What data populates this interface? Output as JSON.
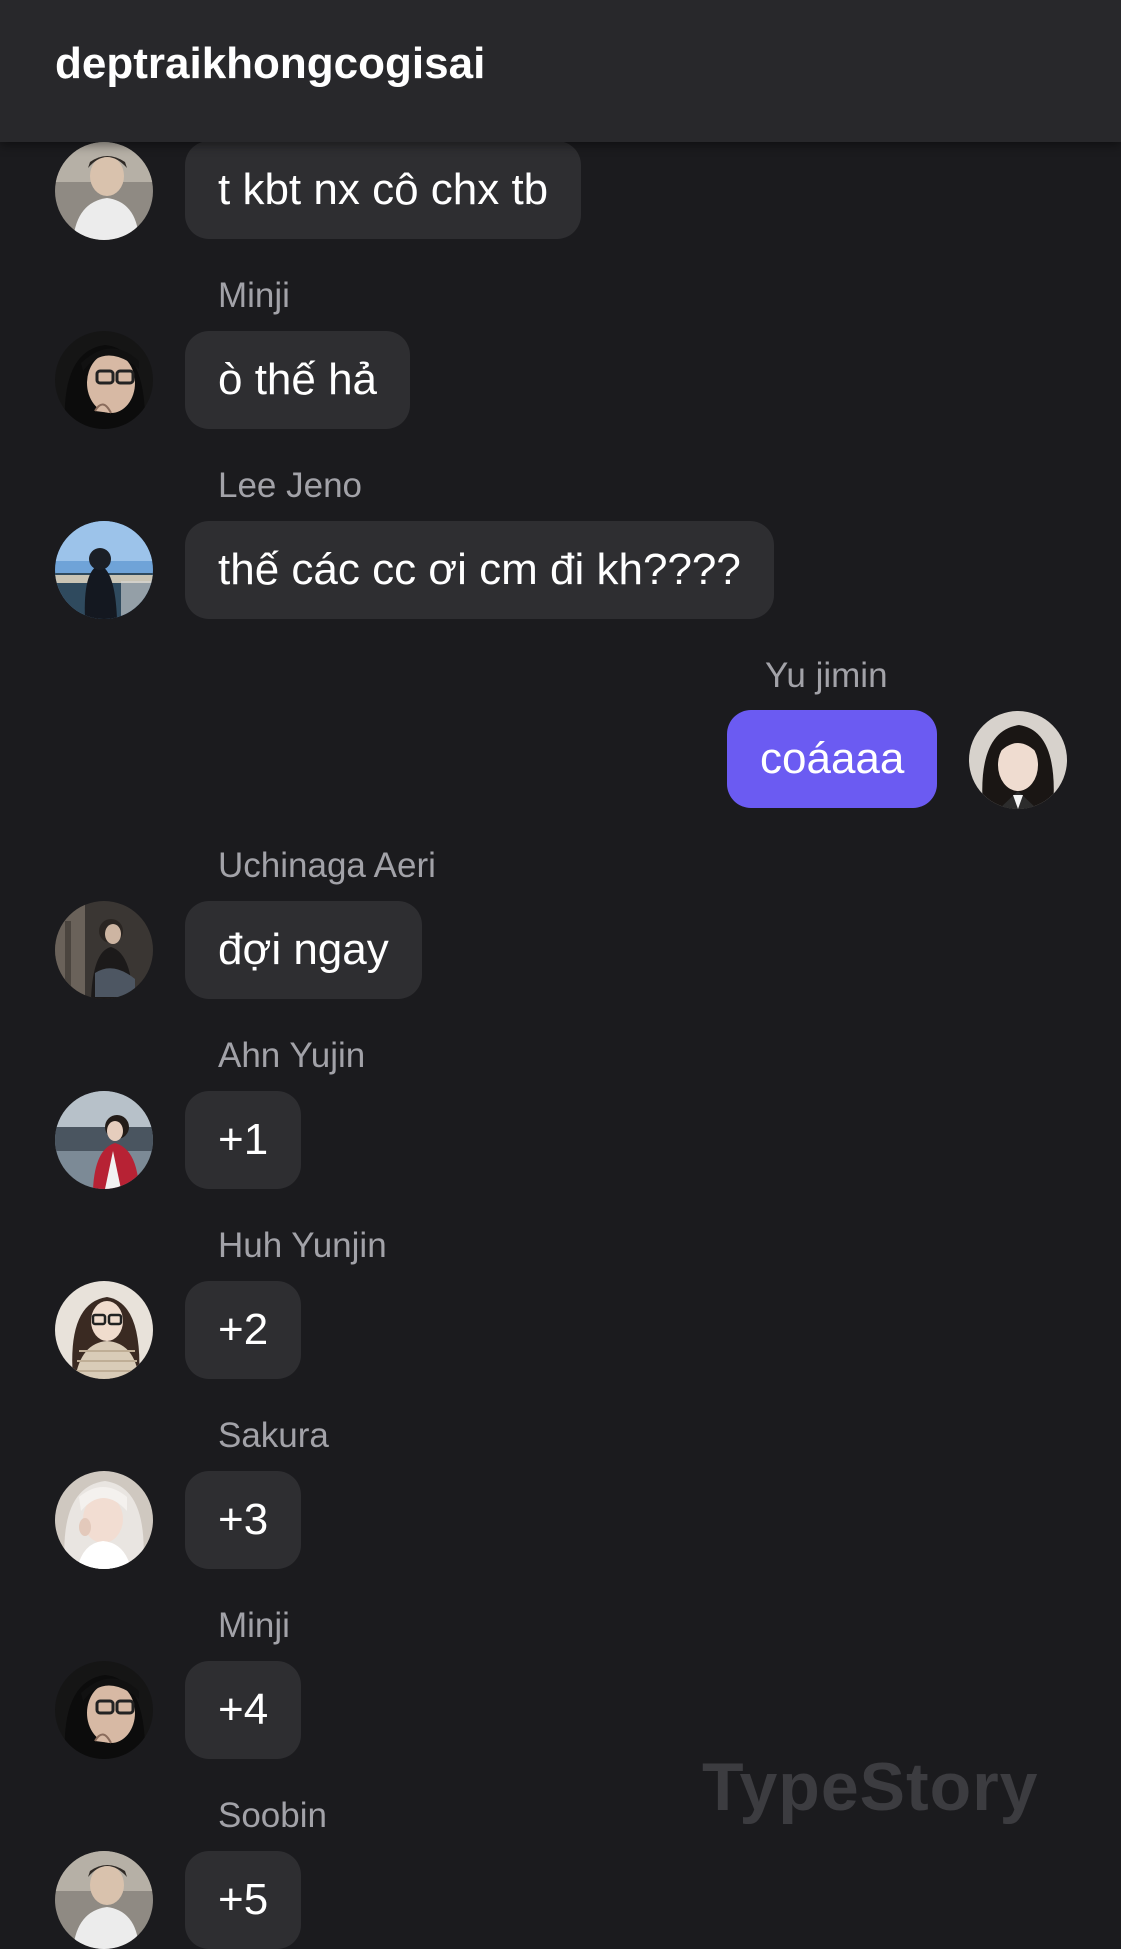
{
  "header": {
    "title": "deptraikhongcogisai"
  },
  "messages": [
    {
      "sender": "",
      "text": "t kbt nx cô chx tb",
      "own": false,
      "avatar": "avatar-boy-white-shirt"
    },
    {
      "sender": "Minji",
      "text": "ò thế hả",
      "own": false,
      "avatar": "avatar-girl-glasses"
    },
    {
      "sender": "Lee Jeno",
      "text": "thế các cc ơi cm đi kh????",
      "own": false,
      "avatar": "avatar-harbor-photo"
    },
    {
      "sender": "Yu jimin",
      "text": "coáaaa",
      "own": true,
      "avatar": "avatar-girl-bangs"
    },
    {
      "sender": "Uchinaga Aeri",
      "text": "đợi ngay",
      "own": false,
      "avatar": "avatar-girl-sitting"
    },
    {
      "sender": "Ahn Yujin",
      "text": "+1",
      "own": false,
      "avatar": "avatar-girl-red-jacket"
    },
    {
      "sender": "Huh Yunjin",
      "text": "+2",
      "own": false,
      "avatar": "avatar-girl-knit-sweater"
    },
    {
      "sender": "Sakura",
      "text": "+3",
      "own": false,
      "avatar": "avatar-girl-white-hair"
    },
    {
      "sender": "Minji",
      "text": "+4",
      "own": false,
      "avatar": "avatar-girl-glasses"
    },
    {
      "sender": "Soobin",
      "text": "+5",
      "own": false,
      "avatar": "avatar-boy-white-shirt"
    }
  ],
  "watermark": "TypeStory",
  "colors": {
    "background": "#1b1b1e",
    "header": "#28282b",
    "bubble": "#2e2e31",
    "own_bubble": "#6b5bf2",
    "sender_text": "#a2a2a8"
  }
}
